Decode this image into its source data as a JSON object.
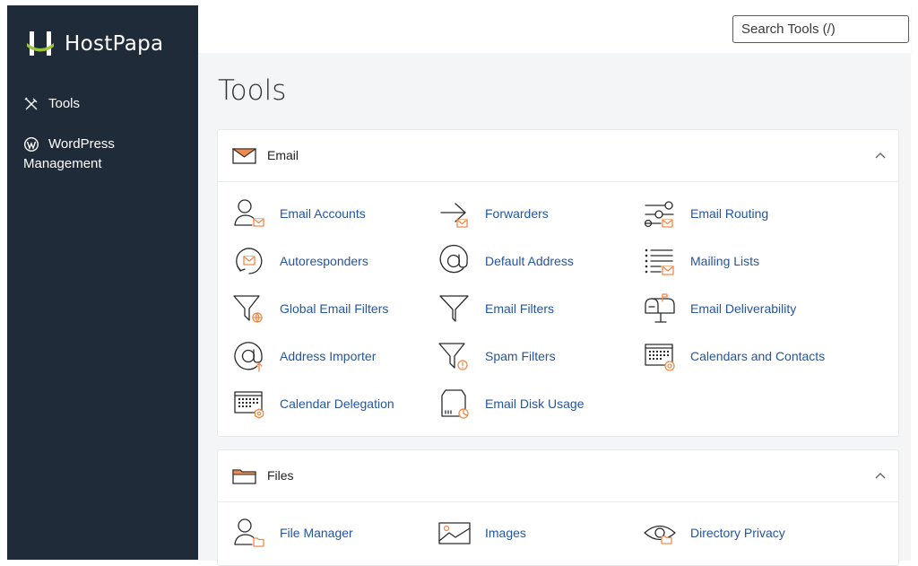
{
  "brand": {
    "name": "HostPapa",
    "accent": "#9cc43e",
    "sidebar_bg": "#1f2b38",
    "link_color": "#24559f",
    "icon_accent": "#f08a4b"
  },
  "sidebar": {
    "items": [
      {
        "label": "Tools",
        "icon": "tools-icon"
      },
      {
        "label_line1": "WordPress",
        "label_line2": "Management",
        "icon": "wordpress-icon"
      }
    ]
  },
  "search": {
    "placeholder": "Search Tools (/)",
    "value": ""
  },
  "page": {
    "title": "Tools"
  },
  "sections": {
    "email": {
      "title": "Email",
      "tools": [
        {
          "label": "Email Accounts",
          "icon": "email-accounts-icon"
        },
        {
          "label": "Forwarders",
          "icon": "forwarders-icon"
        },
        {
          "label": "Email Routing",
          "icon": "email-routing-icon"
        },
        {
          "label": "Autoresponders",
          "icon": "autoresponders-icon"
        },
        {
          "label": "Default Address",
          "icon": "default-address-icon"
        },
        {
          "label": "Mailing Lists",
          "icon": "mailing-lists-icon"
        },
        {
          "label": "Global Email Filters",
          "icon": "global-email-filters-icon"
        },
        {
          "label": "Email Filters",
          "icon": "email-filters-icon"
        },
        {
          "label": "Email Deliverability",
          "icon": "email-deliverability-icon"
        },
        {
          "label": "Address Importer",
          "icon": "address-importer-icon"
        },
        {
          "label": "Spam Filters",
          "icon": "spam-filters-icon"
        },
        {
          "label": "Calendars and Contacts",
          "icon": "calendars-contacts-icon"
        },
        {
          "label": "Calendar Delegation",
          "icon": "calendar-delegation-icon"
        },
        {
          "label": "Email Disk Usage",
          "icon": "email-disk-usage-icon"
        }
      ]
    },
    "files": {
      "title": "Files",
      "tools": [
        {
          "label": "File Manager",
          "icon": "file-manager-icon"
        },
        {
          "label": "Images",
          "icon": "images-icon"
        },
        {
          "label": "Directory Privacy",
          "icon": "directory-privacy-icon"
        }
      ]
    }
  }
}
